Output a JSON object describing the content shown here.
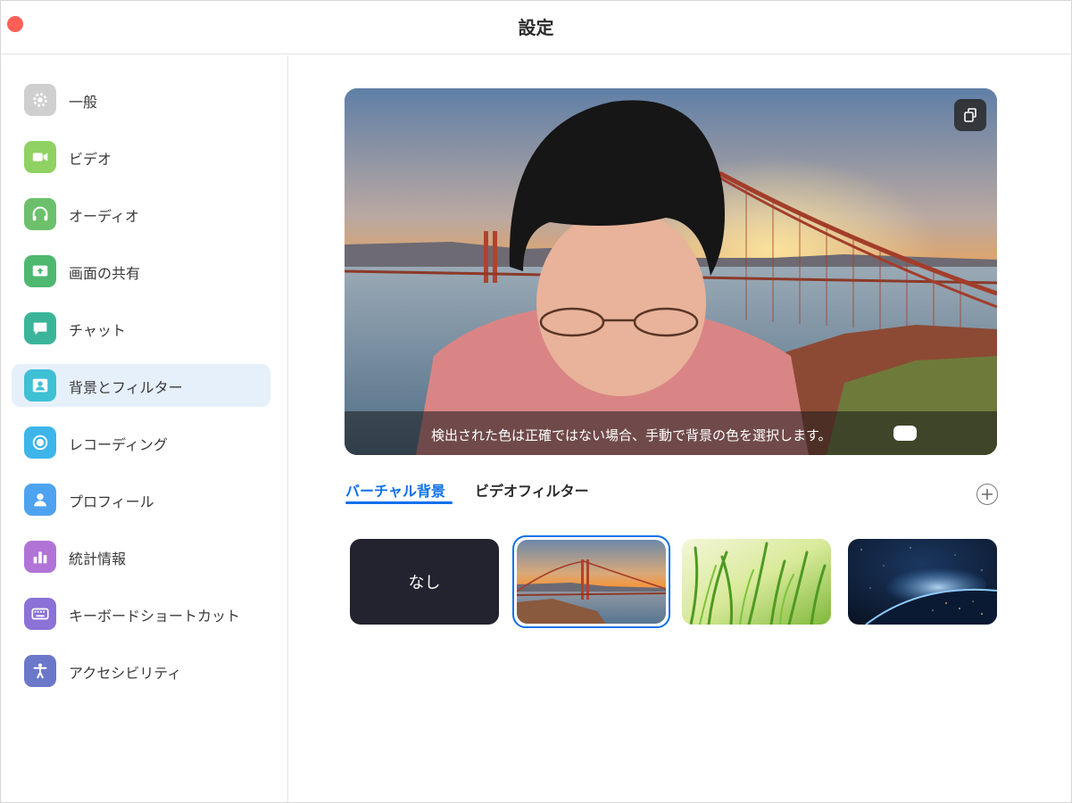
{
  "window": {
    "title": "設定"
  },
  "sidebar": {
    "items": [
      {
        "label": "一般",
        "icon": "gear-icon",
        "color": "#c8c8c8"
      },
      {
        "label": "ビデオ",
        "icon": "video-camera-icon",
        "color": "#8fd163"
      },
      {
        "label": "オーディオ",
        "icon": "headphones-icon",
        "color": "#6cc06c"
      },
      {
        "label": "画面の共有",
        "icon": "share-screen-icon",
        "color": "#4fb86f"
      },
      {
        "label": "チャット",
        "icon": "chat-bubble-icon",
        "color": "#3bb59a"
      },
      {
        "label": "背景とフィルター",
        "icon": "background-person-icon",
        "color": "#3ec0d5",
        "active": true
      },
      {
        "label": "レコーディング",
        "icon": "record-icon",
        "color": "#3db5e8"
      },
      {
        "label": "プロフィール",
        "icon": "profile-icon",
        "color": "#4da3ef"
      },
      {
        "label": "統計情報",
        "icon": "bar-chart-icon",
        "color": "#b074d6"
      },
      {
        "label": "キーボードショートカット",
        "icon": "keyboard-icon",
        "color": "#8a72d6"
      },
      {
        "label": "アクセシビリティ",
        "icon": "accessibility-icon",
        "color": "#6b78c9"
      }
    ]
  },
  "preview": {
    "caption": "検出された色は正確ではない場合、手動で背景の色を選択します。",
    "rotate_icon": "rotate-camera-icon"
  },
  "tabs": {
    "virtual_background": "バーチャル背景",
    "video_filter": "ビデオフィルター",
    "active": "virtual_background"
  },
  "backgrounds": {
    "none_label": "なし",
    "items": [
      "none",
      "golden-gate-bridge",
      "grass",
      "earth"
    ],
    "selected": "golden-gate-bridge"
  },
  "colors": {
    "accent": "#0e71eb",
    "close": "#fe5f57",
    "active_bg": "#e6f0fb"
  }
}
